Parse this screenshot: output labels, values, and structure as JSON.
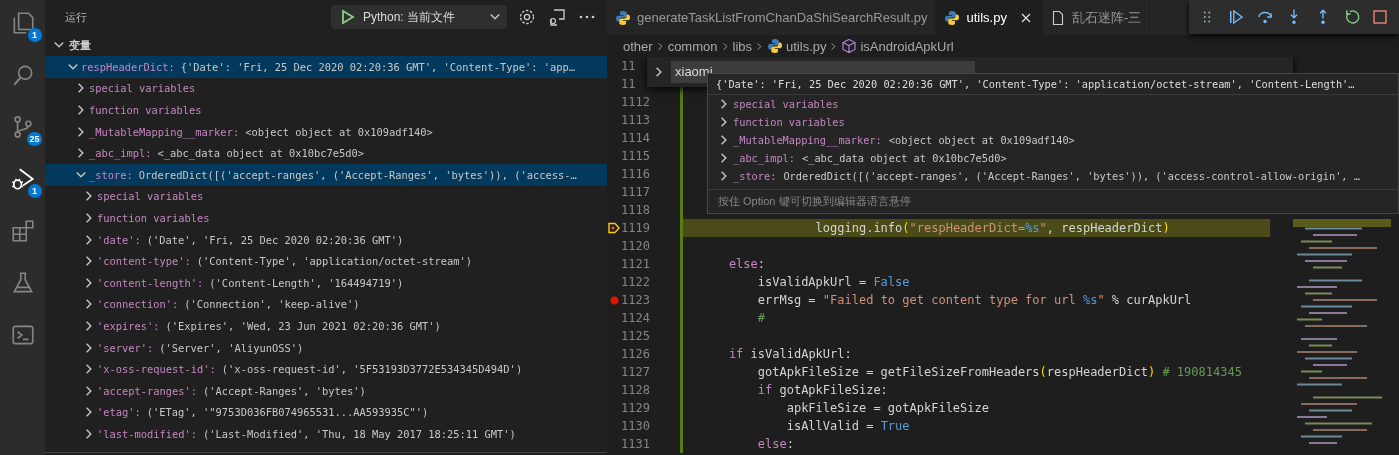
{
  "activity_bar": {
    "items": [
      {
        "kind": "files",
        "badge": "1",
        "selected": false
      },
      {
        "kind": "search",
        "selected": false
      },
      {
        "kind": "source-control",
        "badge": "25",
        "selected": false
      },
      {
        "kind": "run-debug",
        "badge": "1",
        "selected": true
      },
      {
        "kind": "extensions",
        "selected": false
      },
      {
        "kind": "testing",
        "selected": false
      },
      {
        "kind": "terminal",
        "selected": false
      }
    ]
  },
  "side_bar": {
    "title": "运行",
    "run_config": "Python: 当前文件",
    "section": {
      "title": "变量",
      "expanded": true
    },
    "variables": [
      {
        "name": "respHeaderDict:",
        "value": "{'Date': 'Fri, 25 Dec 2020 02:20:36 GMT', 'Content-Type': 'app…",
        "expanded": true,
        "selected": true,
        "children": [
          {
            "name": "special variables",
            "expanded": false,
            "selected": false
          },
          {
            "name": "function variables",
            "expanded": false,
            "selected": false
          },
          {
            "name": "_MutableMapping__marker:",
            "value": "<object object at 0x109adf140>",
            "expanded": false,
            "selected": false
          },
          {
            "name": "_abc_impl:",
            "value": "<_abc_data object at 0x10bc7e5d0>",
            "expanded": false,
            "selected": false
          },
          {
            "name": "_store:",
            "value": "OrderedDict([('accept-ranges', ('Accept-Ranges', 'bytes')), ('access-…",
            "expanded": true,
            "selected": true,
            "children": [
              {
                "name": "special variables",
                "expanded": false,
                "selected": false
              },
              {
                "name": "function variables",
                "expanded": false,
                "selected": false
              },
              {
                "name": "'date':",
                "value": "('Date', 'Fri, 25 Dec 2020 02:20:36 GMT')",
                "expanded": false,
                "selected": false
              },
              {
                "name": "'content-type':",
                "value": "('Content-Type', 'application/octet-stream')",
                "expanded": false,
                "selected": false
              },
              {
                "name": "'content-length':",
                "value": "('Content-Length', '164494719')",
                "expanded": false,
                "selected": false
              },
              {
                "name": "'connection':",
                "value": "('Connection', 'keep-alive')",
                "expanded": false,
                "selected": false
              },
              {
                "name": "'expires':",
                "value": "('Expires', 'Wed, 23 Jun 2021 02:20:36 GMT')",
                "expanded": false,
                "selected": false
              },
              {
                "name": "'server':",
                "value": "('Server', 'AliyunOSS')",
                "expanded": false,
                "selected": false
              },
              {
                "name": "'x-oss-request-id':",
                "value": "('x-oss-request-id', '5F53193D3772E534345D494D')",
                "expanded": false,
                "selected": false
              },
              {
                "name": "'accept-ranges':",
                "value": "('Accept-Ranges', 'bytes')",
                "expanded": false,
                "selected": false
              },
              {
                "name": "'etag':",
                "value": "('ETag', '\"9753D036FB074965531...AA593935C\"')",
                "expanded": false,
                "selected": false
              },
              {
                "name": "'last-modified':",
                "value": "('Last-Modified', 'Thu, 18 May 2017 18:25:11 GMT')",
                "expanded": false,
                "selected": false
              }
            ]
          }
        ]
      }
    ]
  },
  "editor": {
    "tabs": [
      {
        "label": "generateTaskListFromChanDaShiSearchResult.py",
        "kind": "python",
        "selected": false
      },
      {
        "label": "utils.py",
        "kind": "python",
        "selected": true
      },
      {
        "label": "乱石迷阵-三",
        "kind": "file",
        "selected": false
      }
    ],
    "debug_toolbar": [
      {
        "kind": "grip"
      },
      {
        "kind": "continue"
      },
      {
        "kind": "step-over"
      },
      {
        "kind": "step-into"
      },
      {
        "kind": "step-out"
      },
      {
        "kind": "restart"
      },
      {
        "kind": "stop"
      }
    ],
    "breadcrumb": [
      {
        "label": "other",
        "kind": "folder"
      },
      {
        "label": "common",
        "kind": "folder"
      },
      {
        "label": "libs",
        "kind": "folder"
      },
      {
        "label": "utils.py",
        "kind": "python"
      },
      {
        "label": "isAndroidApkUrl",
        "kind": "symbol"
      }
    ],
    "find": {
      "value": "xiaomi"
    },
    "lines": [
      {
        "number": "11",
        "breakpoint": false
      },
      {
        "number": "11",
        "breakpoint": false
      },
      {
        "number": "1112",
        "current": false,
        "breakpoint": false
      },
      {
        "number": "1113",
        "current": false,
        "breakpoint": false
      },
      {
        "number": "1114",
        "current": false,
        "breakpoint": false
      },
      {
        "number": "1115",
        "current": false,
        "breakpoint": false
      },
      {
        "number": "1116",
        "current": false,
        "breakpoint": false
      },
      {
        "number": "1117",
        "current": false,
        "breakpoint": false
      },
      {
        "number": "1118",
        "current": false,
        "breakpoint": false
      },
      {
        "number": "1119",
        "current": true,
        "breakpoint": false,
        "tokens": [
          {
            "text": "                logging.info",
            "kind": "plain"
          },
          {
            "text": "(",
            "kind": "paren"
          },
          {
            "text": "\"respHeaderDict=",
            "kind": "str"
          },
          {
            "text": "%s",
            "kind": "fmt"
          },
          {
            "text": "\"",
            "kind": "str"
          },
          {
            "text": ", respHeaderDict",
            "kind": "plain"
          },
          {
            "text": ")",
            "kind": "paren"
          }
        ]
      },
      {
        "number": "1120",
        "current": false,
        "breakpoint": false
      },
      {
        "number": "1121",
        "current": false,
        "breakpoint": false,
        "tokens": [
          {
            "text": "    else",
            "kind": "kw"
          },
          {
            "text": ":",
            "kind": "plain"
          }
        ]
      },
      {
        "number": "1122",
        "current": false,
        "breakpoint": false,
        "tokens": [
          {
            "text": "        isValidApkUrl = ",
            "kind": "plain"
          },
          {
            "text": "False",
            "kind": "const"
          }
        ]
      },
      {
        "number": "1123",
        "current": false,
        "breakpoint": true,
        "tokens": [
          {
            "text": "        errMsg = ",
            "kind": "plain"
          },
          {
            "text": "\"Failed to get content type for url ",
            "kind": "str"
          },
          {
            "text": "%s",
            "kind": "fmt"
          },
          {
            "text": "\"",
            "kind": "str"
          },
          {
            "text": " % curApkUrl",
            "kind": "plain"
          }
        ]
      },
      {
        "number": "1124",
        "current": false,
        "breakpoint": false,
        "tokens": [
          {
            "text": "        #",
            "kind": "comment"
          }
        ]
      },
      {
        "number": "1125",
        "current": false,
        "breakpoint": false
      },
      {
        "number": "1126",
        "current": false,
        "breakpoint": false,
        "tokens": [
          {
            "text": "    if",
            "kind": "kw"
          },
          {
            "text": " isValidApkUrl:",
            "kind": "plain"
          }
        ]
      },
      {
        "number": "1127",
        "current": false,
        "breakpoint": false,
        "tokens": [
          {
            "text": "        gotApkFileSize = getFileSizeFromHeaders",
            "kind": "plain"
          },
          {
            "text": "(",
            "kind": "paren"
          },
          {
            "text": "respHeaderDict",
            "kind": "plain"
          },
          {
            "text": ")",
            "kind": "paren"
          },
          {
            "text": " # 190814345",
            "kind": "comment"
          }
        ]
      },
      {
        "number": "1128",
        "current": false,
        "breakpoint": false,
        "tokens": [
          {
            "text": "        if",
            "kind": "kw"
          },
          {
            "text": " gotApkFileSize:",
            "kind": "plain"
          }
        ]
      },
      {
        "number": "1129",
        "current": false,
        "breakpoint": false,
        "tokens": [
          {
            "text": "            apkFileSize = gotApkFileSize",
            "kind": "plain"
          }
        ]
      },
      {
        "number": "1130",
        "current": false,
        "breakpoint": false,
        "tokens": [
          {
            "text": "            isAllValid = ",
            "kind": "plain"
          },
          {
            "text": "True",
            "kind": "const"
          }
        ]
      },
      {
        "number": "1131",
        "current": false,
        "breakpoint": false,
        "tokens": [
          {
            "text": "        else",
            "kind": "kw"
          },
          {
            "text": ":",
            "kind": "plain"
          }
        ]
      }
    ],
    "hover": {
      "summary": "{'Date': 'Fri, 25 Dec 2020 02:20:36 GMT', 'Content-Type': 'application/octet-stream', 'Content-Length'…",
      "items": [
        {
          "name": "special variables",
          "expanded": false
        },
        {
          "name": "function variables",
          "expanded": false
        },
        {
          "name": "_MutableMapping__marker:",
          "value": "<object object at 0x109adf140>",
          "expanded": false
        },
        {
          "name": "_abc_impl:",
          "value": "<_abc_data object at 0x10bc7e5d0>",
          "expanded": false
        },
        {
          "name": "_store:",
          "value": "OrderedDict([('accept-ranges', ('Accept-Ranges', 'bytes')), ('access-control-allow-origin', …",
          "expanded": false
        }
      ],
      "hint": "按住 Option 键可切换到编辑器语言悬停"
    }
  }
}
